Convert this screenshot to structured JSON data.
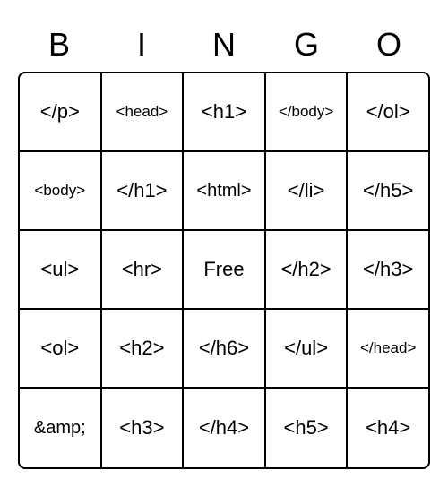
{
  "header": [
    "B",
    "I",
    "N",
    "G",
    "O"
  ],
  "grid": [
    [
      {
        "label": "</p>",
        "size": "lg"
      },
      {
        "label": "<head>",
        "size": "sm"
      },
      {
        "label": "<h1>",
        "size": "lg"
      },
      {
        "label": "</body>",
        "size": "sm"
      },
      {
        "label": "</ol>",
        "size": "lg"
      }
    ],
    [
      {
        "label": "<body>",
        "size": "sm"
      },
      {
        "label": "</h1>",
        "size": "lg"
      },
      {
        "label": "<html>",
        "size": "md"
      },
      {
        "label": "</li>",
        "size": "lg"
      },
      {
        "label": "</h5>",
        "size": "lg"
      }
    ],
    [
      {
        "label": "<ul>",
        "size": "lg"
      },
      {
        "label": "<hr>",
        "size": "lg"
      },
      {
        "label": "Free",
        "size": "lg"
      },
      {
        "label": "</h2>",
        "size": "lg"
      },
      {
        "label": "</h3>",
        "size": "lg"
      }
    ],
    [
      {
        "label": "<ol>",
        "size": "lg"
      },
      {
        "label": "<h2>",
        "size": "lg"
      },
      {
        "label": "</h6>",
        "size": "lg"
      },
      {
        "label": "</ul>",
        "size": "lg"
      },
      {
        "label": "</head>",
        "size": "sm"
      }
    ],
    [
      {
        "label": "&amp;",
        "size": "md"
      },
      {
        "label": "<h3>",
        "size": "lg"
      },
      {
        "label": "</h4>",
        "size": "lg"
      },
      {
        "label": "<h5>",
        "size": "lg"
      },
      {
        "label": "<h4>",
        "size": "lg"
      }
    ]
  ]
}
